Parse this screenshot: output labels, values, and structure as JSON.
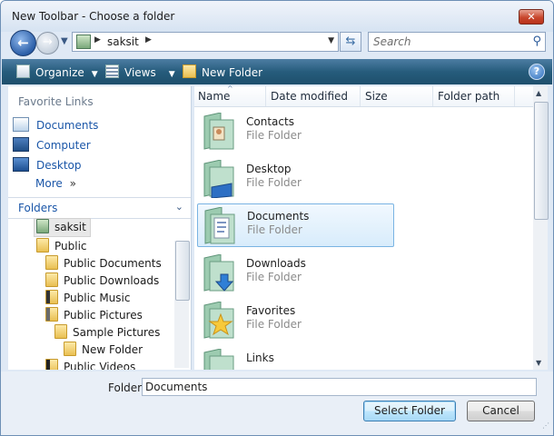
{
  "window": {
    "title": "New Toolbar - Choose a folder",
    "close_label": "✕"
  },
  "nav": {
    "back_glyph": "←",
    "forward_glyph": "→",
    "address_segment": "saksit",
    "search_placeholder": "Search",
    "icons": [
      "back-arrow-icon",
      "forward-arrow-icon",
      "refresh-icon",
      "search-icon"
    ]
  },
  "commandbar": {
    "organize_label": "Organize",
    "views_label": "Views",
    "new_folder_label": "New Folder",
    "help_label": "?"
  },
  "sidebar": {
    "favorites_title": "Favorite Links",
    "favorites": [
      {
        "label": "Documents",
        "icon": "documents-icon"
      },
      {
        "label": "Computer",
        "icon": "computer-icon"
      },
      {
        "label": "Desktop",
        "icon": "desktop-icon"
      }
    ],
    "more_label": "More",
    "more_glyph": "»",
    "folders_label": "Folders",
    "tree": [
      {
        "label": "saksit",
        "icon": "user-folder-icon",
        "selected": true
      },
      {
        "label": "Public",
        "icon": "folder-icon"
      },
      {
        "label": "Public Documents",
        "icon": "folder-icon"
      },
      {
        "label": "Public Downloads",
        "icon": "folder-icon"
      },
      {
        "label": "Public Music",
        "icon": "music-folder-icon"
      },
      {
        "label": "Public Pictures",
        "icon": "pictures-folder-icon"
      },
      {
        "label": "Sample Pictures",
        "icon": "folder-icon"
      },
      {
        "label": "New Folder",
        "icon": "folder-icon"
      },
      {
        "label": "Public Videos",
        "icon": "videos-folder-icon"
      }
    ]
  },
  "columns": {
    "name": "Name",
    "date_modified": "Date modified",
    "size": "Size",
    "folder_path": "Folder path"
  },
  "files": [
    {
      "name": "Contacts",
      "type": "File Folder",
      "icon": "contacts-folder-icon"
    },
    {
      "name": "Desktop",
      "type": "File Folder",
      "icon": "desktop-folder-icon"
    },
    {
      "name": "Documents",
      "type": "File Folder",
      "icon": "documents-folder-icon",
      "selected": true
    },
    {
      "name": "Downloads",
      "type": "File Folder",
      "icon": "downloads-folder-icon"
    },
    {
      "name": "Favorites",
      "type": "File Folder",
      "icon": "favorites-folder-icon"
    },
    {
      "name": "Links",
      "type": "",
      "icon": "links-folder-icon"
    }
  ],
  "bottom": {
    "folder_label": "Folder:",
    "folder_value": "Documents",
    "select_button": "Select Folder",
    "cancel_button": "Cancel"
  },
  "colors": {
    "commandbar": "#265c7c",
    "link_blue": "#1a56a8",
    "selection_border": "#7ab4e3"
  }
}
